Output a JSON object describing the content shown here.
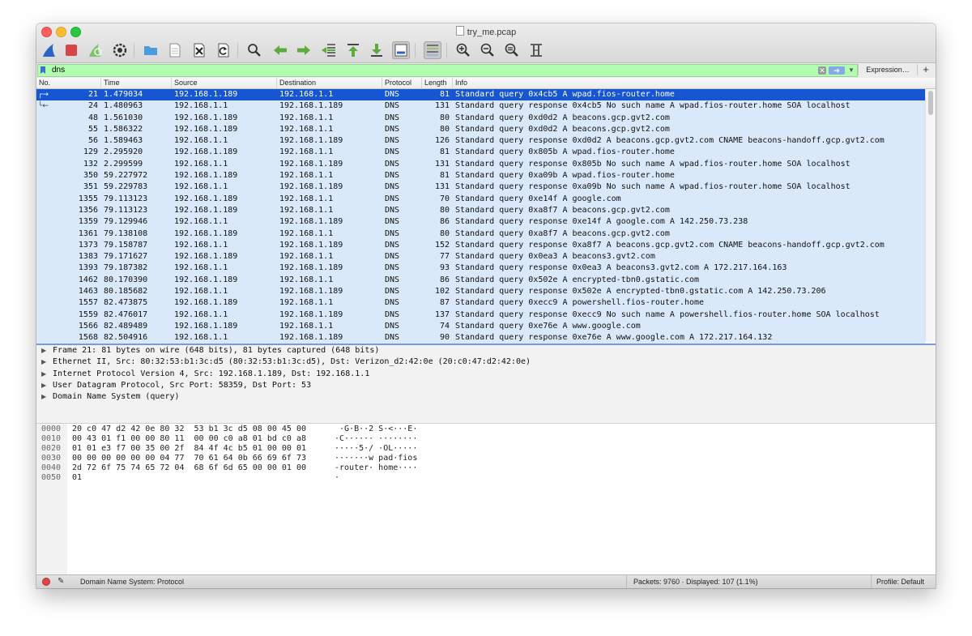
{
  "window": {
    "title": "try_me.pcap"
  },
  "filter": {
    "value": "dns",
    "expression_label": "Expression…",
    "add_label": "+"
  },
  "columns": [
    "No.",
    "Time",
    "Source",
    "Destination",
    "Protocol",
    "Length",
    "Info"
  ],
  "packets": [
    {
      "no": "21",
      "time": "1.479034",
      "src": "192.168.1.189",
      "dst": "192.168.1.1",
      "proto": "DNS",
      "len": "81",
      "info": "Standard query 0x4cb5 A wpad.fios-router.home"
    },
    {
      "no": "24",
      "time": "1.480963",
      "src": "192.168.1.1",
      "dst": "192.168.1.189",
      "proto": "DNS",
      "len": "131",
      "info": "Standard query response 0x4cb5 No such name A wpad.fios-router.home SOA localhost"
    },
    {
      "no": "48",
      "time": "1.561030",
      "src": "192.168.1.189",
      "dst": "192.168.1.1",
      "proto": "DNS",
      "len": "80",
      "info": "Standard query 0xd0d2 A beacons.gcp.gvt2.com"
    },
    {
      "no": "55",
      "time": "1.586322",
      "src": "192.168.1.189",
      "dst": "192.168.1.1",
      "proto": "DNS",
      "len": "80",
      "info": "Standard query 0xd0d2 A beacons.gcp.gvt2.com"
    },
    {
      "no": "56",
      "time": "1.589463",
      "src": "192.168.1.1",
      "dst": "192.168.1.189",
      "proto": "DNS",
      "len": "126",
      "info": "Standard query response 0xd0d2 A beacons.gcp.gvt2.com CNAME beacons-handoff.gcp.gvt2.com"
    },
    {
      "no": "129",
      "time": "2.295920",
      "src": "192.168.1.189",
      "dst": "192.168.1.1",
      "proto": "DNS",
      "len": "81",
      "info": "Standard query 0x805b A wpad.fios-router.home"
    },
    {
      "no": "132",
      "time": "2.299599",
      "src": "192.168.1.1",
      "dst": "192.168.1.189",
      "proto": "DNS",
      "len": "131",
      "info": "Standard query response 0x805b No such name A wpad.fios-router.home SOA localhost"
    },
    {
      "no": "350",
      "time": "59.227972",
      "src": "192.168.1.189",
      "dst": "192.168.1.1",
      "proto": "DNS",
      "len": "81",
      "info": "Standard query 0xa09b A wpad.fios-router.home"
    },
    {
      "no": "351",
      "time": "59.229783",
      "src": "192.168.1.1",
      "dst": "192.168.1.189",
      "proto": "DNS",
      "len": "131",
      "info": "Standard query response 0xa09b No such name A wpad.fios-router.home SOA localhost"
    },
    {
      "no": "1355",
      "time": "79.113123",
      "src": "192.168.1.189",
      "dst": "192.168.1.1",
      "proto": "DNS",
      "len": "70",
      "info": "Standard query 0xe14f A google.com"
    },
    {
      "no": "1356",
      "time": "79.113123",
      "src": "192.168.1.189",
      "dst": "192.168.1.1",
      "proto": "DNS",
      "len": "80",
      "info": "Standard query 0xa8f7 A beacons.gcp.gvt2.com"
    },
    {
      "no": "1359",
      "time": "79.129946",
      "src": "192.168.1.1",
      "dst": "192.168.1.189",
      "proto": "DNS",
      "len": "86",
      "info": "Standard query response 0xe14f A google.com A 142.250.73.238"
    },
    {
      "no": "1361",
      "time": "79.138108",
      "src": "192.168.1.189",
      "dst": "192.168.1.1",
      "proto": "DNS",
      "len": "80",
      "info": "Standard query 0xa8f7 A beacons.gcp.gvt2.com"
    },
    {
      "no": "1373",
      "time": "79.158787",
      "src": "192.168.1.1",
      "dst": "192.168.1.189",
      "proto": "DNS",
      "len": "152",
      "info": "Standard query response 0xa8f7 A beacons.gcp.gvt2.com CNAME beacons-handoff.gcp.gvt2.com"
    },
    {
      "no": "1383",
      "time": "79.171627",
      "src": "192.168.1.189",
      "dst": "192.168.1.1",
      "proto": "DNS",
      "len": "77",
      "info": "Standard query 0x0ea3 A beacons3.gvt2.com"
    },
    {
      "no": "1393",
      "time": "79.187382",
      "src": "192.168.1.1",
      "dst": "192.168.1.189",
      "proto": "DNS",
      "len": "93",
      "info": "Standard query response 0x0ea3 A beacons3.gvt2.com A 172.217.164.163"
    },
    {
      "no": "1462",
      "time": "80.170390",
      "src": "192.168.1.189",
      "dst": "192.168.1.1",
      "proto": "DNS",
      "len": "86",
      "info": "Standard query 0x502e A encrypted-tbn0.gstatic.com"
    },
    {
      "no": "1463",
      "time": "80.185682",
      "src": "192.168.1.1",
      "dst": "192.168.1.189",
      "proto": "DNS",
      "len": "102",
      "info": "Standard query response 0x502e A encrypted-tbn0.gstatic.com A 142.250.73.206"
    },
    {
      "no": "1557",
      "time": "82.473875",
      "src": "192.168.1.189",
      "dst": "192.168.1.1",
      "proto": "DNS",
      "len": "87",
      "info": "Standard query 0xecc9 A powershell.fios-router.home"
    },
    {
      "no": "1559",
      "time": "82.476017",
      "src": "192.168.1.1",
      "dst": "192.168.1.189",
      "proto": "DNS",
      "len": "137",
      "info": "Standard query response 0xecc9 No such name A powershell.fios-router.home SOA localhost"
    },
    {
      "no": "1566",
      "time": "82.489489",
      "src": "192.168.1.189",
      "dst": "192.168.1.1",
      "proto": "DNS",
      "len": "74",
      "info": "Standard query 0xe76e A www.google.com"
    },
    {
      "no": "1568",
      "time": "82.504916",
      "src": "192.168.1.1",
      "dst": "192.168.1.189",
      "proto": "DNS",
      "len": "90",
      "info": "Standard query response 0xe76e A www.google.com A 172.217.164.132"
    }
  ],
  "selected_row": 0,
  "details": [
    "Frame 21: 81 bytes on wire (648 bits), 81 bytes captured (648 bits)",
    "Ethernet II, Src: 80:32:53:b1:3c:d5 (80:32:53:b1:3c:d5), Dst: Verizon_d2:42:0e (20:c0:47:d2:42:0e)",
    "Internet Protocol Version 4, Src: 192.168.1.189, Dst: 192.168.1.1",
    "User Datagram Protocol, Src Port: 58359, Dst Port: 53",
    "Domain Name System (query)"
  ],
  "bytes": [
    {
      "off": "0000",
      "hex": "20 c0 47 d2 42 0e 80 32  53 b1 3c d5 08 00 45 00",
      "ascii": " ·G·B··2 S·<···E·"
    },
    {
      "off": "0010",
      "hex": "00 43 01 f1 00 00 80 11  00 00 c0 a8 01 bd c0 a8",
      "ascii": "·C······ ········"
    },
    {
      "off": "0020",
      "hex": "01 01 e3 f7 00 35 00 2f  84 4f 4c b5 01 00 00 01",
      "ascii": "·····5·/ ·OL·····"
    },
    {
      "off": "0030",
      "hex": "00 00 00 00 00 00 04 77  70 61 64 0b 66 69 6f 73",
      "ascii": "·······w pad·fios"
    },
    {
      "off": "0040",
      "hex": "2d 72 6f 75 74 65 72 04  68 6f 6d 65 00 00 01 00",
      "ascii": "-router· home····"
    },
    {
      "off": "0050",
      "hex": "01",
      "ascii": "·"
    }
  ],
  "status": {
    "field": "Domain Name System: Protocol",
    "packets": "Packets: 9760 · Displayed: 107 (1.1%)",
    "profile": "Profile: Default"
  },
  "colors": {
    "selection": "#1756d3",
    "row_bg": "#dae9fa",
    "filter_ok": "#afffaf"
  }
}
